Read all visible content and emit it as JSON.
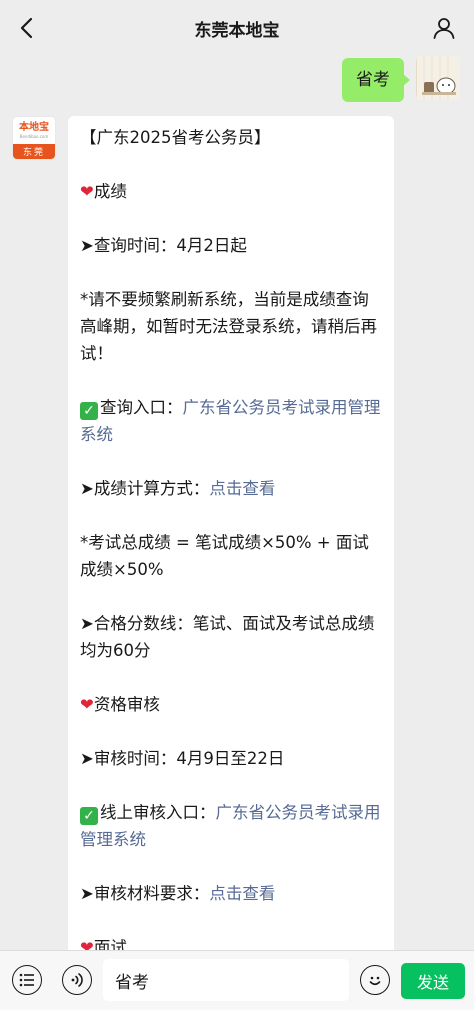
{
  "header": {
    "title": "东莞本地宝",
    "back_icon": "chevron-left-icon",
    "profile_icon": "person-icon"
  },
  "messages": {
    "outgoing": {
      "text": "省考"
    },
    "brand_avatar": {
      "logo_text": "本地宝",
      "logo_sub": "Bendibao.com",
      "city": "东莞"
    },
    "incoming": {
      "title": "【广东2025省考公务员】",
      "section1_heading": "成绩",
      "query_time": "➤查询时间：4月2日起",
      "notice": "*请不要频繁刷新系统，当前是成绩查询高峰期，如暂时无法登录系统，请稍后再试！",
      "query_entry_label": "查询入口：",
      "query_entry_link": "广东省公务员考试录用管理系统",
      "calc_label": "➤成绩计算方式：",
      "calc_link": "点击查看",
      "formula": "*考试总成绩 = 笔试成绩×50% + 面试成绩×50%",
      "pass_line": "➤合格分数线：笔试、面试及考试总成绩均为60分",
      "section2_heading": "资格审核",
      "review_time": "➤审核时间：4月9日至22日",
      "review_entry_label": "线上审核入口：",
      "review_entry_link": "广东省公务员考试录用管理系统",
      "material_label": "➤审核材料要求：",
      "material_link": "点击查看",
      "section3_heading": "面试"
    }
  },
  "inputbar": {
    "input_value": "省考",
    "send_label": "发送"
  },
  "colors": {
    "accent_green": "#07c160",
    "bubble_out": "#95ec69",
    "link": "#576b95",
    "brand_orange": "#e8541e"
  }
}
